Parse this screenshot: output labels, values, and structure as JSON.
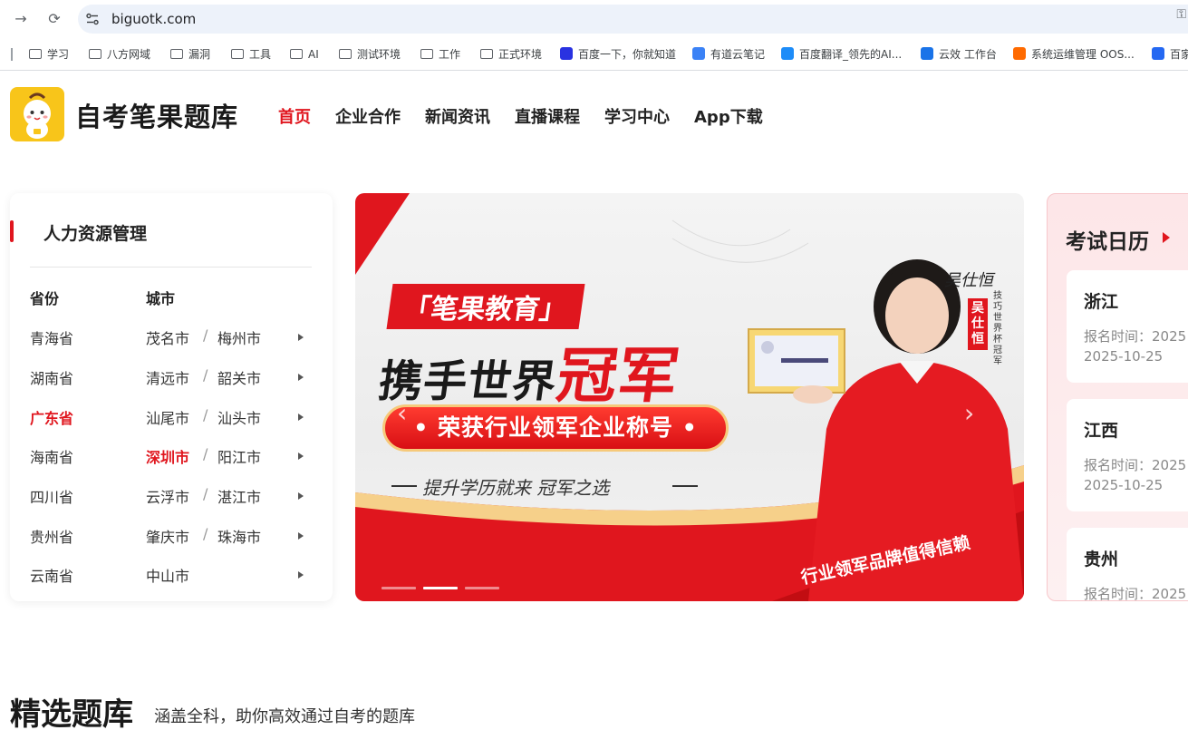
{
  "browser": {
    "url": "biguotk.com",
    "bookmarks": [
      {
        "label": "学习",
        "kind": "folder"
      },
      {
        "label": "八方网域",
        "kind": "folder"
      },
      {
        "label": "漏洞",
        "kind": "folder"
      },
      {
        "label": "工具",
        "kind": "folder"
      },
      {
        "label": "AI",
        "kind": "folder"
      },
      {
        "label": "测试环境",
        "kind": "folder"
      },
      {
        "label": "工作",
        "kind": "folder"
      },
      {
        "label": "正式环境",
        "kind": "folder"
      },
      {
        "label": "百度一下，你就知道",
        "kind": "site",
        "color": "#2932e1"
      },
      {
        "label": "有道云笔记",
        "kind": "site",
        "color": "#3b82f6"
      },
      {
        "label": "百度翻译_领先的AI...",
        "kind": "site",
        "color": "#1d8cf8"
      },
      {
        "label": "云效 工作台",
        "kind": "site",
        "color": "#1a73e8"
      },
      {
        "label": "系统运维管理 OOS...",
        "kind": "site",
        "color": "#ff6a00"
      },
      {
        "label": "百家",
        "kind": "site",
        "color": "#2468f2"
      }
    ]
  },
  "header": {
    "site_title": "自考笔果题库",
    "nav": [
      {
        "label": "首页",
        "active": true
      },
      {
        "label": "企业合作",
        "active": false
      },
      {
        "label": "新闻资讯",
        "active": false
      },
      {
        "label": "直播课程",
        "active": false
      },
      {
        "label": "学习中心",
        "active": false
      },
      {
        "label": "App下载",
        "active": false
      }
    ]
  },
  "category": {
    "title": "人力资源管理",
    "province_header": "省份",
    "city_header": "城市",
    "provinces": [
      "青海省",
      "湖南省",
      "广东省",
      "海南省",
      "四川省",
      "贵州省",
      "云南省"
    ],
    "active_province": "广东省",
    "city_rows": [
      [
        "茂名市",
        "梅州市"
      ],
      [
        "清远市",
        "韶关市"
      ],
      [
        "汕尾市",
        "汕头市"
      ],
      [
        "深圳市",
        "阳江市"
      ],
      [
        "云浮市",
        "湛江市"
      ],
      [
        "肇庆市",
        "珠海市"
      ],
      [
        "中山市"
      ]
    ],
    "active_city": "深圳市",
    "separator": "/"
  },
  "banner": {
    "tag": "「笔果教育」",
    "headline_a": "携手世界",
    "headline_b": "冠军",
    "pill": "• 荣获行业领军企业称号 •",
    "sub": "提升学历就来 冠军之选",
    "corner": "行业领军品牌值得信赖",
    "name_tag": "吴仕恒",
    "name_sub": "技巧世界杯冠军",
    "signature": "吴仕恒",
    "slide_count": 3,
    "active_slide": 1,
    "accent": "#e0161e"
  },
  "calendar": {
    "title": "考试日历",
    "items": [
      {
        "province": "浙江",
        "line1": "报名时间：2025",
        "line2": "2025-10-25"
      },
      {
        "province": "江西",
        "line1": "报名时间：2025",
        "line2": "2025-10-25"
      },
      {
        "province": "贵州",
        "line1": "报名时间：2025",
        "line2": ""
      }
    ]
  },
  "section": {
    "title": "精选题库",
    "subtitle": "涵盖全科，助你高效通过自考的题库"
  }
}
